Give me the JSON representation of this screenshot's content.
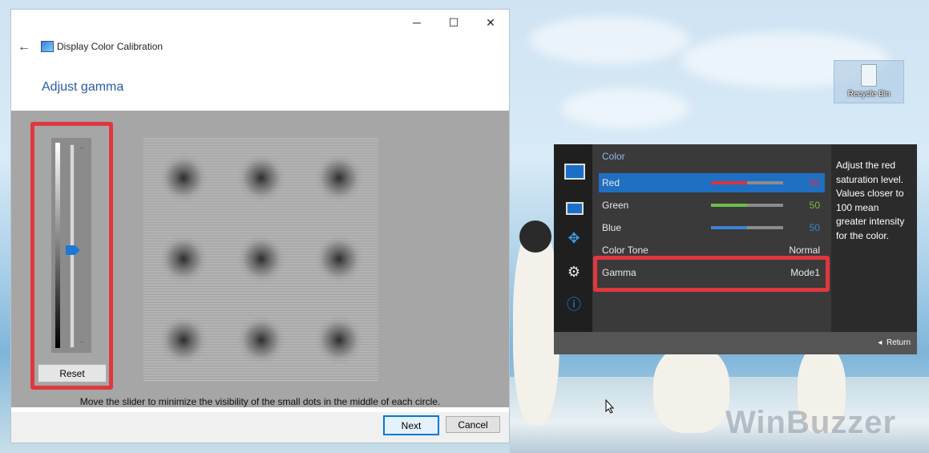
{
  "dialog": {
    "app_title": "Display Color Calibration",
    "heading": "Adjust gamma",
    "reset_label": "Reset",
    "instruction": "Move the slider to minimize the visibility of the small dots in the middle of each circle.",
    "next_label": "Next",
    "cancel_label": "Cancel",
    "window_controls": {
      "minimize": "─",
      "maximize": "☐",
      "close": "✕"
    },
    "back_icon": "←"
  },
  "osd": {
    "title": "Color",
    "rows": [
      {
        "label": "Red",
        "value": "50",
        "bar_fraction": 0.5,
        "bar_color": "#d9343c",
        "value_color": "#d9343c"
      },
      {
        "label": "Green",
        "value": "50",
        "bar_fraction": 0.5,
        "bar_color": "#6cc04a",
        "value_color": "#6cc04a"
      },
      {
        "label": "Blue",
        "value": "50",
        "bar_fraction": 0.5,
        "bar_color": "#3b82d6",
        "value_color": "#3b82d6"
      },
      {
        "label": "Color Tone",
        "value": "Normal"
      },
      {
        "label": "Gamma",
        "value": "Mode1"
      }
    ],
    "help_text": "Adjust the red saturation level. Values closer to 100 mean greater intensity for the color.",
    "return_label": "Return",
    "sidebar_icons": [
      "monitor-icon",
      "picture-icon",
      "resize-icon",
      "gear-icon",
      "info-icon"
    ]
  },
  "desktop": {
    "recycle_bin_label": "Recycle Bin",
    "watermark": "WinBuzzer"
  },
  "colors": {
    "highlight": "#e0373f",
    "accent": "#0078d7",
    "heading": "#2a5aa6"
  }
}
